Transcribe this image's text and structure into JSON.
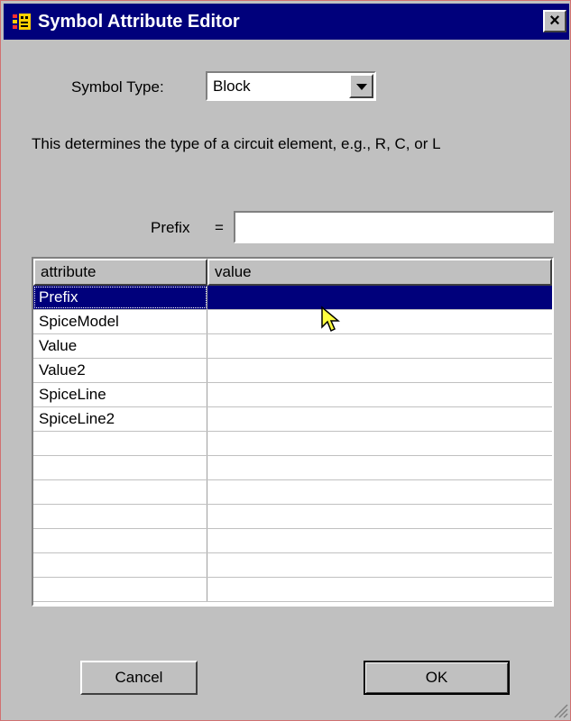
{
  "window": {
    "title": "Symbol Attribute Editor",
    "close_label": "×"
  },
  "symbol_type": {
    "label": "Symbol Type:",
    "selected": "Block"
  },
  "description": "This determines the type of a circuit element, e.g., R, C, or L",
  "prefix": {
    "label": "Prefix",
    "equals": "=",
    "value": ""
  },
  "table": {
    "columns": [
      "attribute",
      "value"
    ],
    "rows": [
      {
        "attribute": "Prefix",
        "value": ""
      },
      {
        "attribute": "SpiceModel",
        "value": ""
      },
      {
        "attribute": "Value",
        "value": ""
      },
      {
        "attribute": "Value2",
        "value": ""
      },
      {
        "attribute": "SpiceLine",
        "value": ""
      },
      {
        "attribute": "SpiceLine2",
        "value": ""
      }
    ]
  },
  "buttons": {
    "cancel": "Cancel",
    "ok": "OK"
  },
  "colors": {
    "titlebar": "#00007b",
    "selection": "#00007b",
    "face": "#c0c0c0"
  }
}
